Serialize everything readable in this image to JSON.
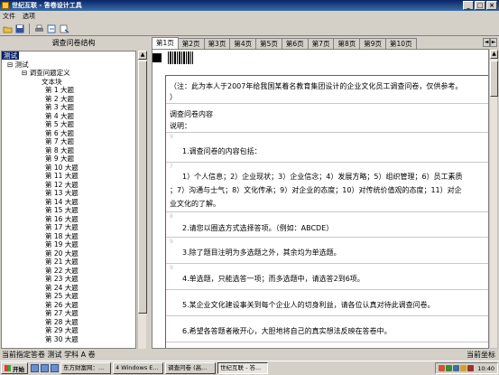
{
  "window": {
    "title": "世纪互联 - 答卷设计工具",
    "controls": [
      "_",
      "□",
      "×"
    ]
  },
  "menu": [
    "文件",
    "选项"
  ],
  "toolbar": {
    "icons": [
      "open-icon",
      "save-icon",
      "print-icon",
      "export-icon",
      "help-icon"
    ]
  },
  "left_panel": {
    "title": "调查问卷结构",
    "tree": {
      "root": "测试",
      "child": "测试",
      "definition": "调查问题定义",
      "textblock": "文本块",
      "items": [
        "第 1 大题",
        "第 2 大题",
        "第 3 大题",
        "第 4 大题",
        "第 5 大题",
        "第 6 大题",
        "第 7 大题",
        "第 8 大题",
        "第 9 大题",
        "第 10 大题",
        "第 11 大题",
        "第 12 大题",
        "第 13 大题",
        "第 14 大题",
        "第 15 大题",
        "第 16 大题",
        "第 17 大题",
        "第 18 大题",
        "第 19 大题",
        "第 20 大题",
        "第 21 大题",
        "第 22 大题",
        "第 23 大题",
        "第 24 大题",
        "第 25 大题",
        "第 26 大题",
        "第 27 大题",
        "第 28 大题",
        "第 29 大题",
        "第 30 大题"
      ]
    }
  },
  "tabs": [
    "第1页",
    "第2页",
    "第3页",
    "第4页",
    "第5页",
    "第6页",
    "第7页",
    "第8页",
    "第9页",
    "第10页"
  ],
  "document": {
    "lines": [
      "（注：此为本人于2007年给我国某着名教育集团设计的企业文化员工调查问卷，仅供参考。",
      "）",
      "调查问卷内容",
      "说明：",
      "1.调查问卷的内容包括：",
      "1）个人信息；2）企业现状；3）企业信念；4）发展方略；5）组织管理；6）员工素质",
      "；7）沟通与士气；8）文化传承；9）对企业的态度；10）对传统价值观的态度；11）对企",
      "业文化的了解。",
      "2.请您以圈选方式选择答项。（例如：ABCDE）",
      "3.除了题目注明为多选题之外，其余均为单选题。",
      "4.单选题，只能选答一项；而多选题中，请选答2到6项。",
      "5.某企业文化建设事关到每个企业人的切身利益，请各位认真对待此调查问卷。",
      "6.希望各答题者敞开心，大胆地将自己的真实想法反映在答卷中。"
    ],
    "line_numbers": [
      "9",
      "7",
      "8",
      "9",
      "9"
    ]
  },
  "status": {
    "left": "当前指定答卷 测试 学科 A 卷",
    "right": "当前坐标"
  },
  "taskbar": {
    "start": "开始",
    "tasks": [
      "东方财富网：...",
      "4 Windows E...",
      "调查问卷 (高...",
      "世纪互联 - 答..."
    ],
    "clock": "10:40"
  }
}
